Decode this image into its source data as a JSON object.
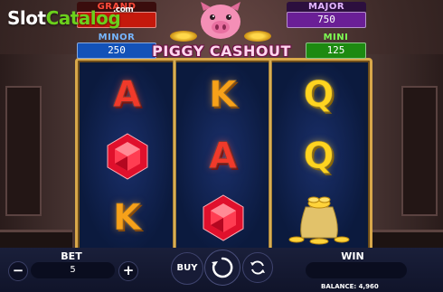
{
  "watermark": {
    "slot": "Slot",
    "catalog": "Catalog",
    "com": ".com"
  },
  "title": "PIGGY CASHOUT",
  "jackpots": {
    "grand": {
      "label": "GRAND",
      "value": ""
    },
    "minor": {
      "label": "MINOR",
      "value": "250"
    },
    "major": {
      "label": "MAJOR",
      "value": "750"
    },
    "mini": {
      "label": "MINI",
      "value": "125"
    }
  },
  "reels": [
    [
      {
        "symbol": "A",
        "color": "red"
      },
      {
        "symbol": "ruby-gem",
        "color": "red"
      },
      {
        "symbol": "K",
        "color": "orange"
      }
    ],
    [
      {
        "symbol": "K",
        "color": "orange"
      },
      {
        "symbol": "A",
        "color": "red"
      },
      {
        "symbol": "ruby-gem",
        "color": "red"
      }
    ],
    [
      {
        "symbol": "Q",
        "color": "gold"
      },
      {
        "symbol": "Q",
        "color": "gold"
      },
      {
        "symbol": "gold-coin-sack",
        "color": "gold"
      }
    ]
  ],
  "controls": {
    "bet_label": "BET",
    "bet_value": "5",
    "minus": "−",
    "plus": "+",
    "buy_label": "BUY",
    "win_label": "WIN",
    "win_value": "",
    "balance_text": "BALANCE: 4,960"
  },
  "colors": {
    "grand": "#c4190c",
    "minor": "#1352b8",
    "major": "#6a1f96",
    "mini": "#1d8a11",
    "frame": "#d9a84a"
  }
}
